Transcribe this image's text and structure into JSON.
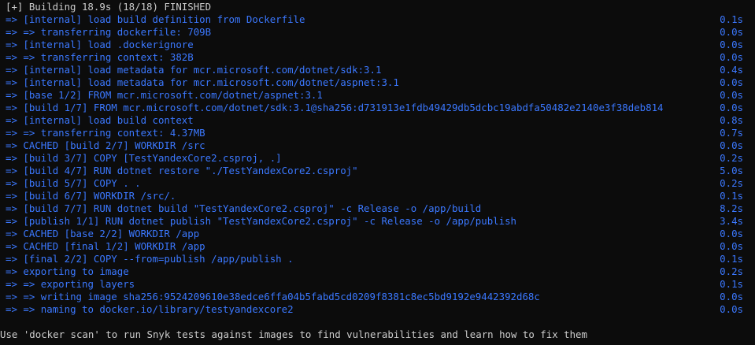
{
  "header": "[+] Building 18.9s (18/18) FINISHED",
  "steps": [
    {
      "arrow": "=>",
      "text": "[internal] load build definition from Dockerfile",
      "time": "0.1s"
    },
    {
      "arrow": "=>",
      "text": "=> transferring dockerfile: 709B",
      "time": "0.0s"
    },
    {
      "arrow": "=>",
      "text": "[internal] load .dockerignore",
      "time": "0.0s"
    },
    {
      "arrow": "=>",
      "text": "=> transferring context: 382B",
      "time": "0.0s"
    },
    {
      "arrow": "=>",
      "text": "[internal] load metadata for mcr.microsoft.com/dotnet/sdk:3.1",
      "time": "0.4s"
    },
    {
      "arrow": "=>",
      "text": "[internal] load metadata for mcr.microsoft.com/dotnet/aspnet:3.1",
      "time": "0.0s"
    },
    {
      "arrow": "=>",
      "text": "[base 1/2] FROM mcr.microsoft.com/dotnet/aspnet:3.1",
      "time": "0.0s"
    },
    {
      "arrow": "=>",
      "text": "[build 1/7] FROM mcr.microsoft.com/dotnet/sdk:3.1@sha256:d731913e1fdb49429db5dcbc19abdfa50482e2140e3f38deb814",
      "time": "0.0s"
    },
    {
      "arrow": "=>",
      "text": "[internal] load build context",
      "time": "0.8s"
    },
    {
      "arrow": "=>",
      "text": "=> transferring context: 4.37MB",
      "time": "0.7s"
    },
    {
      "arrow": "=>",
      "text": "CACHED [build 2/7] WORKDIR /src",
      "time": "0.0s"
    },
    {
      "arrow": "=>",
      "text": "[build 3/7] COPY [TestYandexCore2.csproj, .]",
      "time": "0.2s"
    },
    {
      "arrow": "=>",
      "text": "[build 4/7] RUN dotnet restore \"./TestYandexCore2.csproj\"",
      "time": "5.0s"
    },
    {
      "arrow": "=>",
      "text": "[build 5/7] COPY . .",
      "time": "0.2s"
    },
    {
      "arrow": "=>",
      "text": "[build 6/7] WORKDIR /src/.",
      "time": "0.1s"
    },
    {
      "arrow": "=>",
      "text": "[build 7/7] RUN dotnet build \"TestYandexCore2.csproj\" -c Release -o /app/build",
      "time": "8.2s"
    },
    {
      "arrow": "=>",
      "text": "[publish 1/1] RUN dotnet publish \"TestYandexCore2.csproj\" -c Release -o /app/publish",
      "time": "3.4s"
    },
    {
      "arrow": "=>",
      "text": "CACHED [base 2/2] WORKDIR /app",
      "time": "0.0s"
    },
    {
      "arrow": "=>",
      "text": "CACHED [final 1/2] WORKDIR /app",
      "time": "0.0s"
    },
    {
      "arrow": "=>",
      "text": "[final 2/2] COPY --from=publish /app/publish .",
      "time": "0.1s"
    },
    {
      "arrow": "=>",
      "text": "exporting to image",
      "time": "0.2s"
    },
    {
      "arrow": "=>",
      "text": "=> exporting layers",
      "time": "0.1s"
    },
    {
      "arrow": "=>",
      "text": "=> writing image sha256:9524209610e38edce6ffa04b5fabd5cd0209f8381c8ec5bd9192e9442392d68c",
      "time": "0.0s"
    },
    {
      "arrow": "=>",
      "text": "=> naming to docker.io/library/testyandexcore2",
      "time": "0.0s"
    }
  ],
  "footer": "Use 'docker scan' to run Snyk tests against images to find vulnerabilities and learn how to fix them",
  "colors": {
    "background": "#0c0c0c",
    "default_text": "#cccccc",
    "step_text": "#3b78ff"
  }
}
